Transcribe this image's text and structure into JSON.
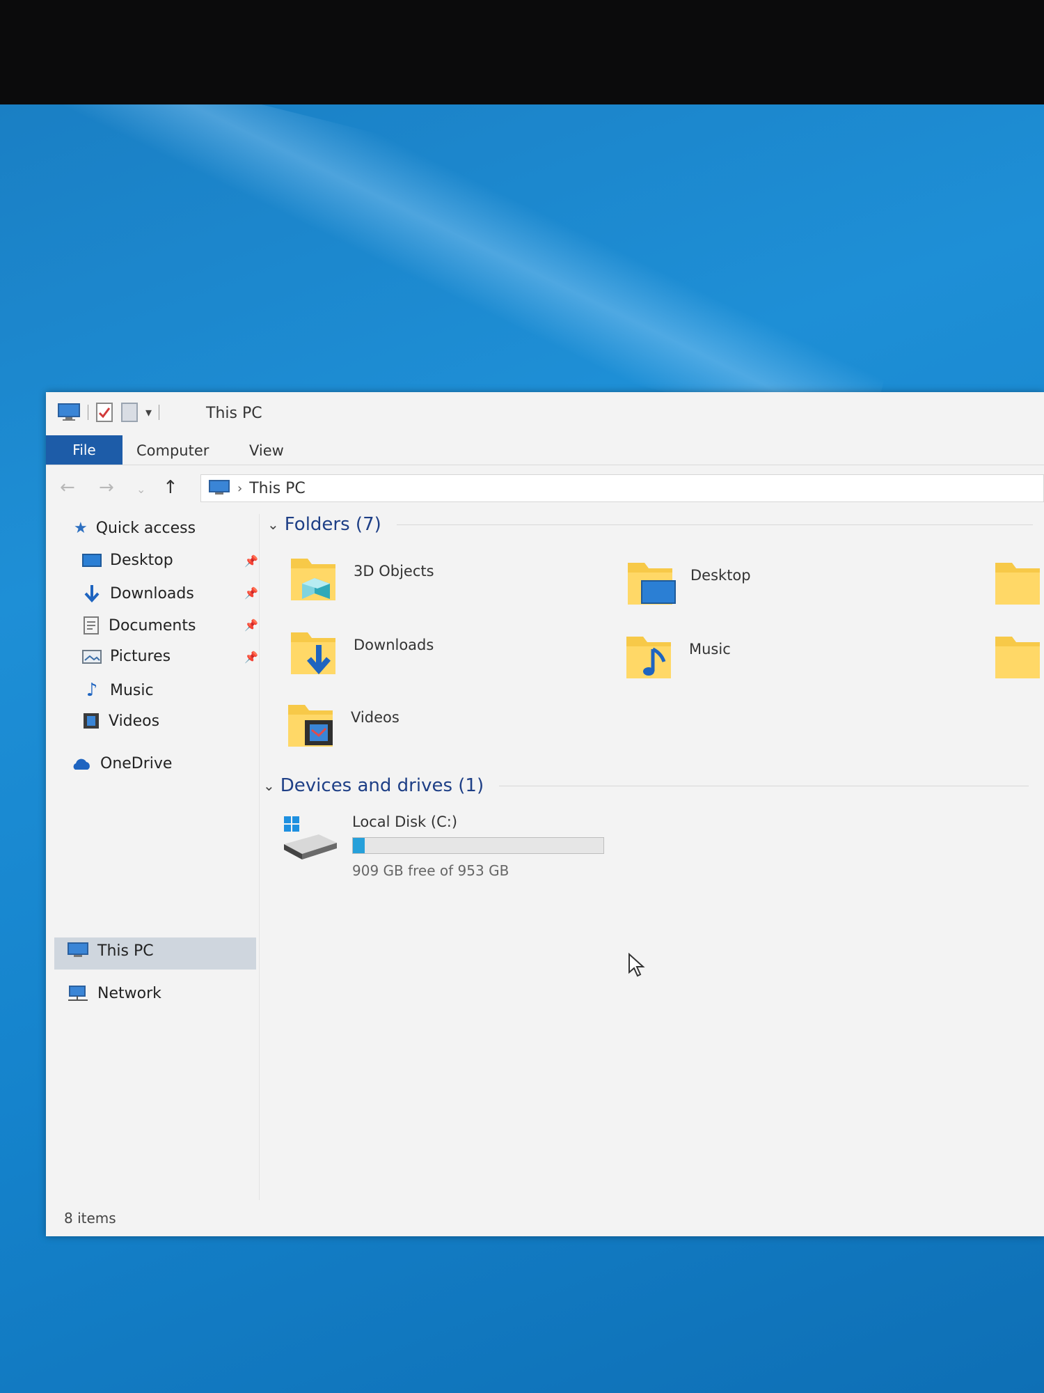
{
  "window": {
    "title": "This PC"
  },
  "ribbon": {
    "file": "File",
    "computer": "Computer",
    "view": "View"
  },
  "address": {
    "crumb": "This PC"
  },
  "sidebar": {
    "quick_access": "Quick access",
    "items": [
      "Desktop",
      "Downloads",
      "Documents",
      "Pictures",
      "Music",
      "Videos"
    ],
    "onedrive": "OneDrive",
    "thispc": "This PC",
    "network": "Network"
  },
  "folders": {
    "header": "Folders (7)",
    "items": [
      "3D Objects",
      "Desktop",
      "Downloads",
      "Music",
      "Videos"
    ]
  },
  "devices": {
    "header": "Devices and drives (1)",
    "drive": {
      "name": "Local Disk (C:)",
      "free_text": "909 GB free of 953 GB",
      "used_fraction": 0.046
    }
  },
  "status": {
    "items": "8 items"
  },
  "colors": {
    "accent": "#1d5ca8",
    "drive_bar": "#26a0da",
    "folder": "#f7c948"
  }
}
